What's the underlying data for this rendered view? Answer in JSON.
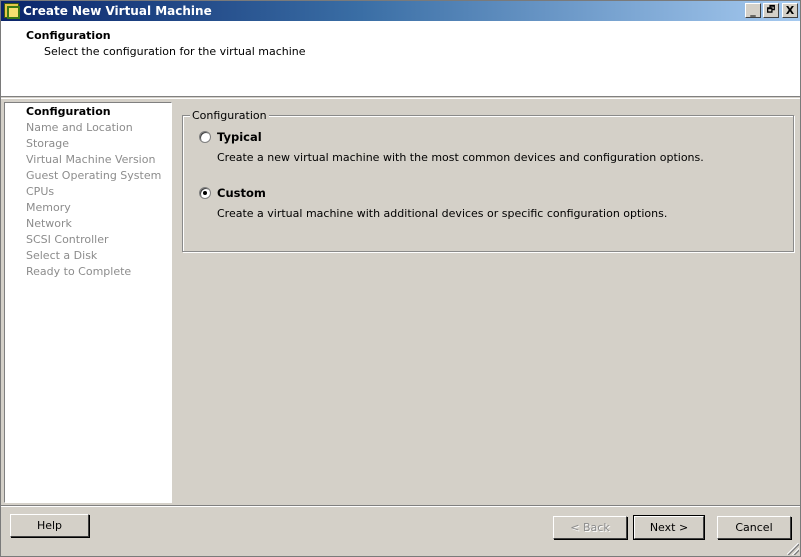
{
  "window": {
    "title": "Create New Virtual Machine",
    "minimize_label": "_",
    "restore_label": "🗗",
    "close_label": "X"
  },
  "header": {
    "title": "Configuration",
    "subtitle": "Select the configuration for the virtual machine"
  },
  "nav": {
    "items": [
      {
        "label": "Configuration",
        "active": true
      },
      {
        "label": "Name and Location",
        "active": false
      },
      {
        "label": "Storage",
        "active": false
      },
      {
        "label": "Virtual Machine Version",
        "active": false
      },
      {
        "label": "Guest Operating System",
        "active": false
      },
      {
        "label": "CPUs",
        "active": false
      },
      {
        "label": "Memory",
        "active": false
      },
      {
        "label": "Network",
        "active": false
      },
      {
        "label": "SCSI Controller",
        "active": false
      },
      {
        "label": "Select a Disk",
        "active": false
      },
      {
        "label": "Ready to Complete",
        "active": false
      }
    ]
  },
  "config": {
    "group_label": "Configuration",
    "selected": "custom",
    "options": [
      {
        "id": "typical",
        "label": "Typical",
        "description": "Create a new virtual machine with the most common devices and configuration options."
      },
      {
        "id": "custom",
        "label": "Custom",
        "description": "Create a virtual machine with additional devices or specific configuration options."
      }
    ]
  },
  "buttons": {
    "help": "Help",
    "back": "< Back",
    "next": "Next >",
    "cancel": "Cancel"
  }
}
